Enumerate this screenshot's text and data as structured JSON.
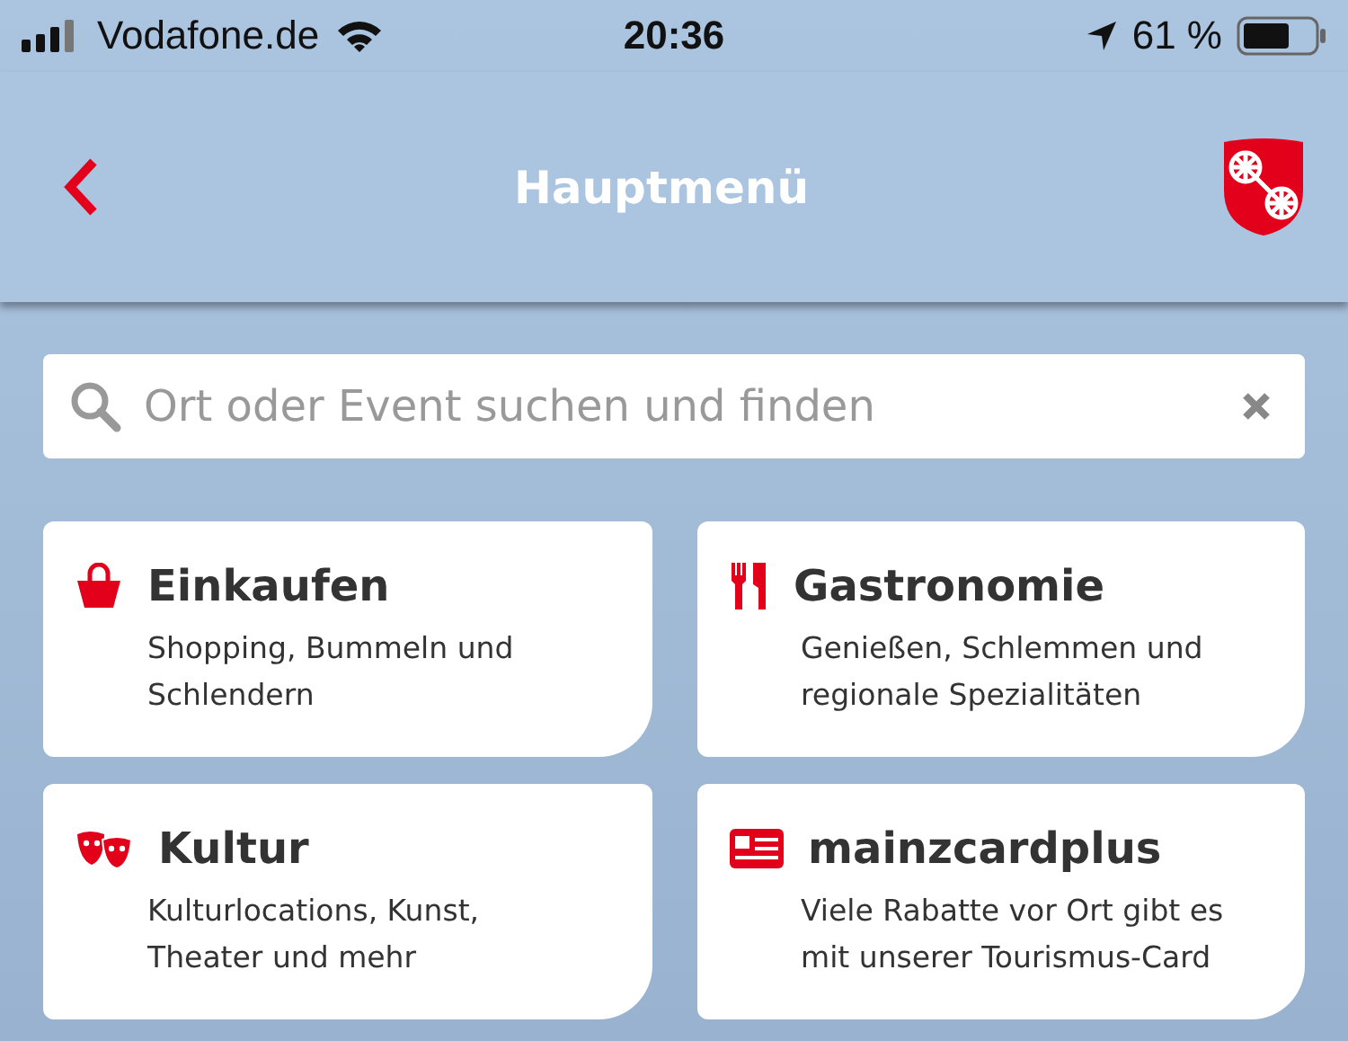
{
  "status_bar": {
    "carrier": "Vodafone.de",
    "time": "20:36",
    "battery": "61 %"
  },
  "nav": {
    "title": "Hauptmenü"
  },
  "search": {
    "placeholder": "Ort oder Event suchen und finden"
  },
  "tiles": [
    {
      "kind": "shopping",
      "title": "Einkaufen",
      "text": "Shopping, Bummeln und Schlendern"
    },
    {
      "kind": "food",
      "title": "Gastronomie",
      "text": "Genießen, Schlemmen und regionale Spezialitäten"
    },
    {
      "kind": "culture",
      "title": "Kultur",
      "text": "Kulturlocations, Kunst, Theater und mehr"
    },
    {
      "kind": "card",
      "title": "mainzcardplus",
      "text": "Viele Rabatte vor Ort gibt es mit unserer Tourismus-Card"
    }
  ]
}
